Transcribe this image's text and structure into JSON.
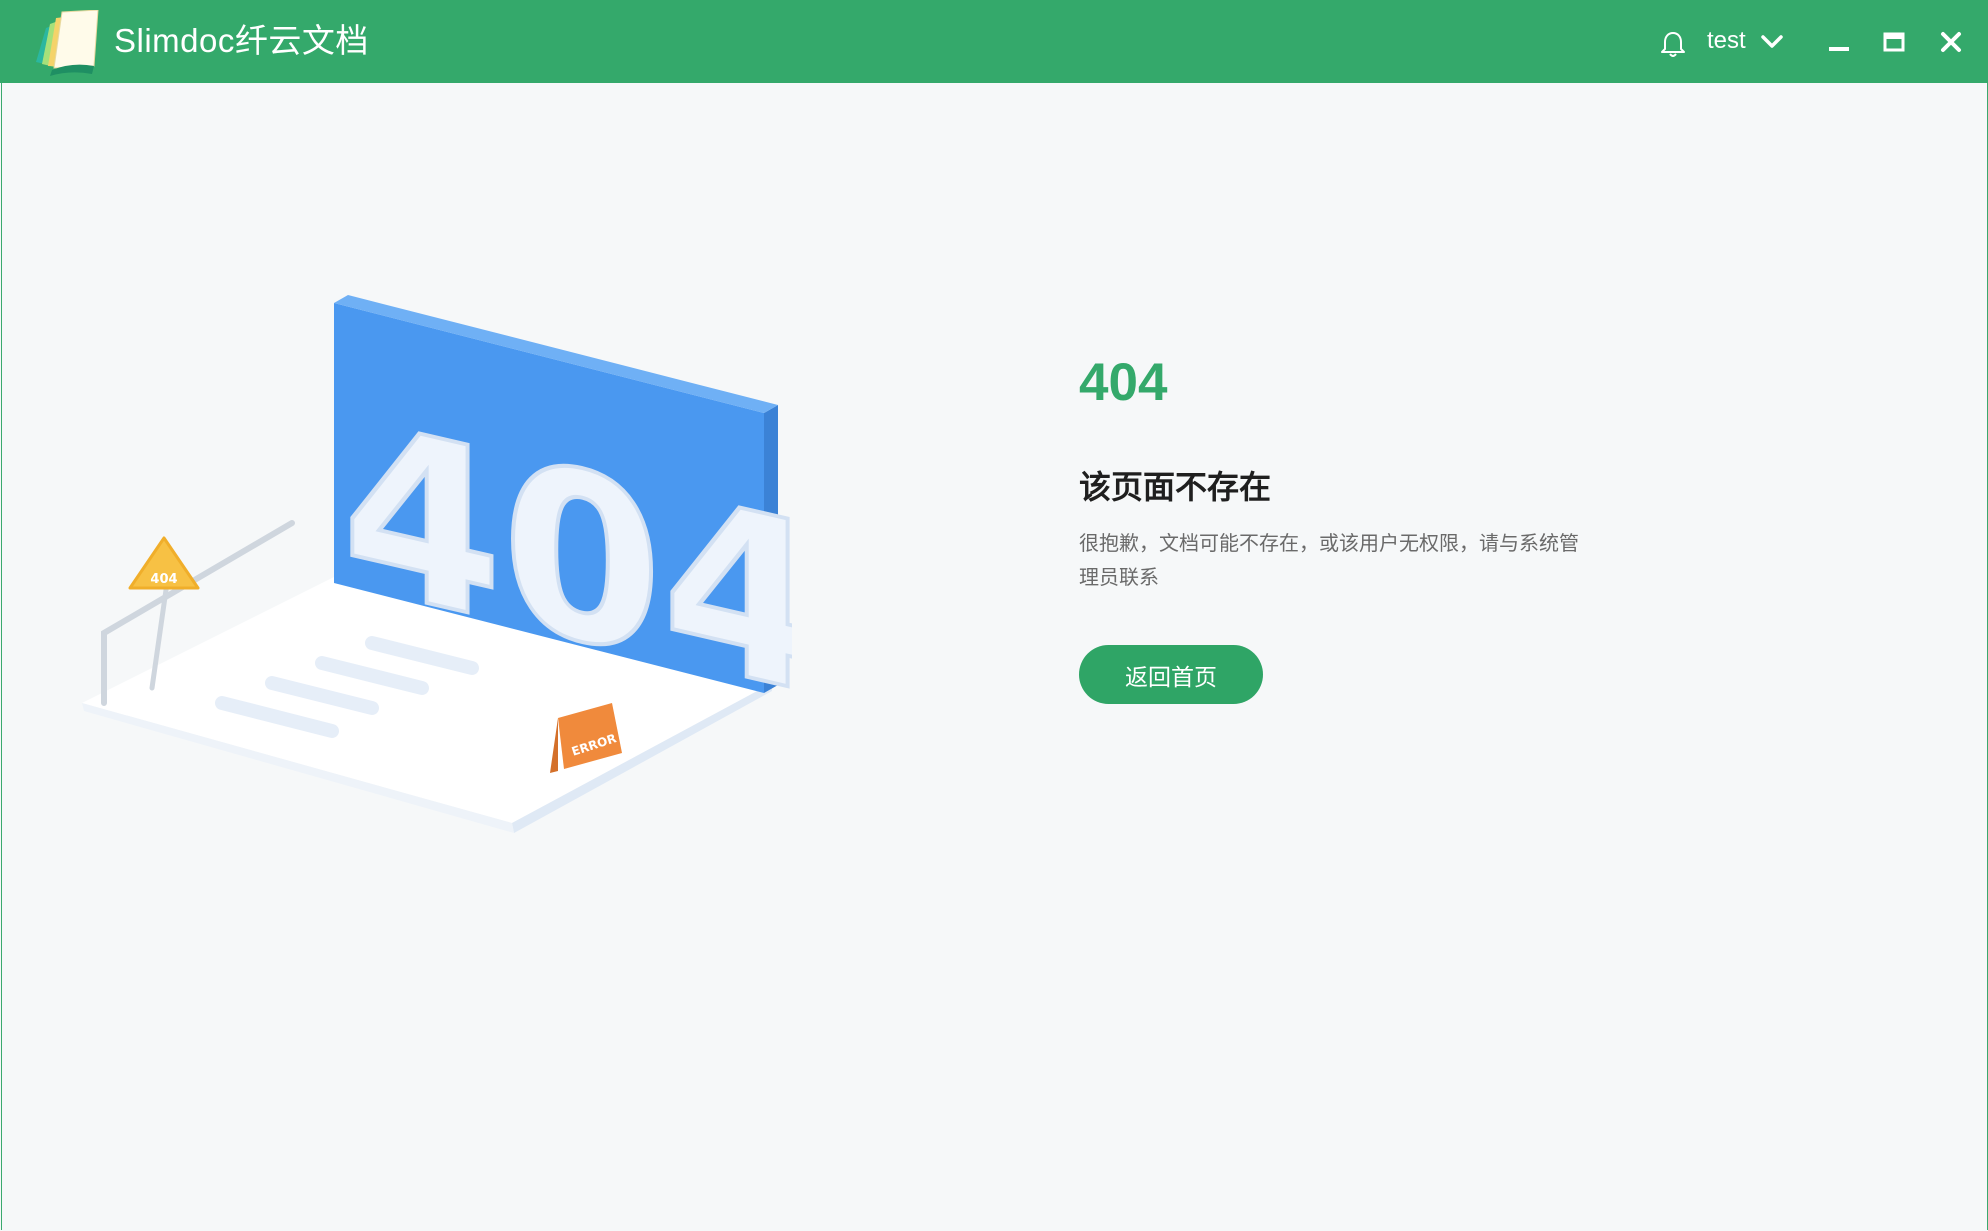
{
  "app": {
    "title": "Slimdoc纤云文档"
  },
  "titlebar": {
    "user_name": "test",
    "icons": {
      "notification": "bell-icon",
      "user_menu": "chevron-down-icon",
      "minimize": "minimize-icon",
      "maximize": "maximize-icon",
      "close": "close-icon"
    }
  },
  "error_page": {
    "code": "404",
    "title": "该页面不存在",
    "description": "很抱歉，文档可能不存在，或该用户无权限，请与系统管理员联系",
    "home_button_label": "返回首页",
    "illustration": {
      "board_text": "404",
      "sign_text": "404",
      "easel_text": "ERROR"
    }
  },
  "colors": {
    "brand_green": "#34a96b",
    "button_green": "#2fa566",
    "illustration_blue": "#4a98f0",
    "warning_yellow": "#f7c144",
    "error_orange": "#f08a3c"
  }
}
